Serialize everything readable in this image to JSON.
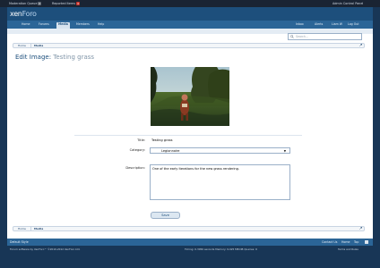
{
  "adminbar": {
    "moderation_queue": "Moderation Queue",
    "moderation_count": "0",
    "reported_items": "Reported Items",
    "reported_count": "4",
    "admin_link": "Admin Control Panel"
  },
  "logo": {
    "part1": "xen",
    "part2": "Foro"
  },
  "nav": {
    "tabs": [
      "Home",
      "Forums",
      "Media",
      "Members",
      "Help"
    ],
    "active_index": 2,
    "right_items": [
      "Inbox",
      "Alerts",
      "Liam W",
      "Log Out"
    ]
  },
  "search": {
    "placeholder": "Search..."
  },
  "breadcrumb": {
    "home": "Home",
    "current": "Media"
  },
  "page": {
    "title_prefix": "Edit Image:",
    "title_name": "Testing grass"
  },
  "form": {
    "title_label": "Title:",
    "title_value": "Testing grass",
    "category_label": "Category:",
    "category_value": "Legionnaire",
    "description_label": "Description:",
    "description_value": "One of the early iterations for the new grass rendering.",
    "save_label": "Save"
  },
  "footer": {
    "style_label": "Default Style",
    "links": [
      "Contact Us",
      "Home",
      "Top"
    ],
    "copyright": "Forum software by XenForo™ ©2010-2012 XenForo Ltd.",
    "timing": "Timing: 0.3056 seconds Memory: 9.025 MB DB Queries: 9",
    "terms": "Terms and Rules"
  },
  "colors": {
    "header": "#1d4f7c",
    "navbar": "#2b6597",
    "accent": "#1d4f7c",
    "background": "#183656"
  }
}
